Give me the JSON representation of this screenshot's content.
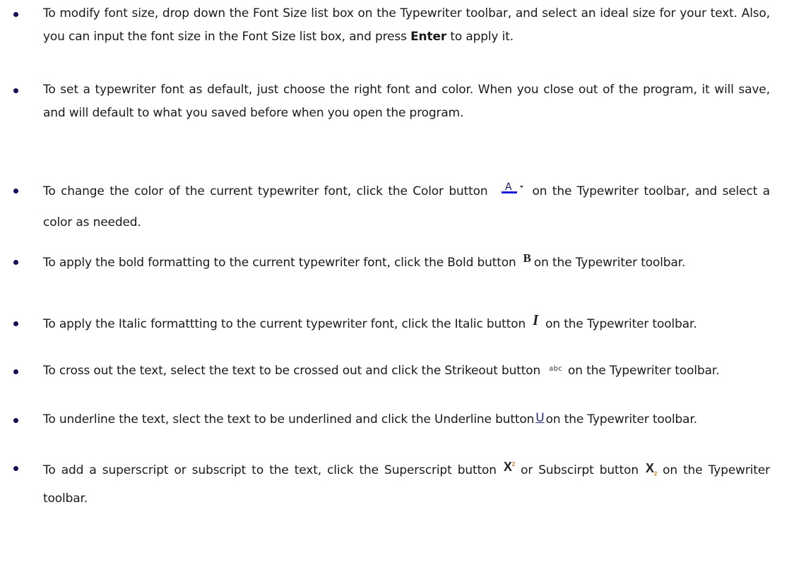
{
  "bullets": [
    {
      "id": "font-size",
      "parts": [
        "To modify font size, drop down the Font Size list box on the Typewriter toolbar, and select an ideal size for your text. Also, you can input the font size in the Font Size list box, and press ",
        "Enter",
        " to apply it."
      ]
    },
    {
      "id": "default-font",
      "parts": [
        "To set a typewriter font as default, just choose the right font and color. When you close out of the program, it will save, and will default to what you saved before when you open the program."
      ]
    },
    {
      "id": "color",
      "parts": [
        "To change the color of the current typewriter font, click the Color button",
        "on the Typewriter toolbar, and select a color as needed."
      ],
      "icon": "font-color-icon",
      "icon_glyph": "A",
      "icon_color": "#1a1adc"
    },
    {
      "id": "bold",
      "parts": [
        "To apply the bold formatting to the current typewriter font, click the Bold button",
        "on the Typewriter toolbar."
      ],
      "icon": "bold-icon",
      "icon_glyph": "B"
    },
    {
      "id": "italic",
      "parts": [
        "To apply the Italic formattting to the current typewriter font, click the Italic button",
        "on the Typewriter toolbar."
      ],
      "icon": "italic-icon",
      "icon_glyph": "I"
    },
    {
      "id": "strikeout",
      "parts": [
        "To cross out the text, select the text to be crossed out and click the Strikeout button",
        "on the Typewriter toolbar."
      ],
      "icon": "strikeout-icon",
      "icon_glyph": "abc"
    },
    {
      "id": "underline",
      "parts": [
        "To underline the text, slect the text to be underlined and click the Underline button",
        "on the Typewriter toolbar."
      ],
      "icon": "underline-icon",
      "icon_glyph": "U"
    },
    {
      "id": "super-subscript",
      "parts": [
        "To add a superscript or subscript to the text, click the Superscript button",
        "or Subscirpt button",
        "on the Typewriter toolbar."
      ],
      "icons": [
        "superscript-icon",
        "subscript-icon"
      ],
      "icon_glyphs": [
        "X",
        "X"
      ],
      "icon_marks": [
        "2",
        "2"
      ]
    }
  ],
  "colors": {
    "bullet": "#10105a",
    "text": "#1a1a1a",
    "color_icon_underline": "#1a1adc"
  }
}
